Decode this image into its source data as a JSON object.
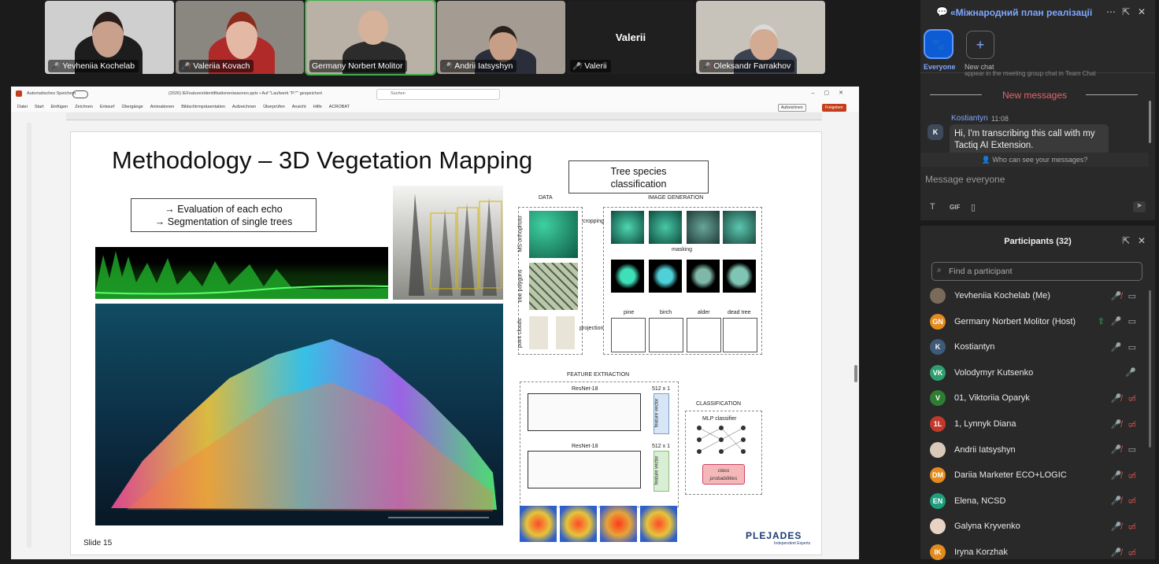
{
  "participants_strip": [
    {
      "name": "Yevheniia Kochelab"
    },
    {
      "name": "Valeriia Kovach"
    },
    {
      "name": "Germany Norbert Molitor"
    },
    {
      "name": "Andrii Iatsyshyn"
    },
    {
      "name": "Valerii",
      "center_label": "Valerii"
    },
    {
      "name": "Oleksandr Farrakhov"
    }
  ],
  "ppt": {
    "autosave": "Automatisches Speichern",
    "file": "(2026) IEFeaturesIdentifikationeniwaoneo.pptx • Auf \"Laufwerk \"P:\"\" gespeichert",
    "search": "Suchen",
    "menu": [
      "Datei",
      "Start",
      "Einfügen",
      "Zeichnen",
      "Entwurf",
      "Übergänge",
      "Animationen",
      "Bildschirmpräsentation",
      "Aufzeichnen",
      "Überprüfen",
      "Ansicht",
      "Hilfe",
      "ACROBAT"
    ],
    "record_btn": "Aufzeichnen",
    "share_btn": "Freigeben",
    "slide_label": "Slide 15"
  },
  "slide": {
    "title": "Methodology – 3D Vegetation Mapping",
    "box1_line1": "→ Evaluation of each echo",
    "box1_line2": "→ Segmentation of single trees",
    "box2_line1": "Tree species",
    "box2_line2": "classification",
    "logo": "PLEJADES",
    "logo_sub": "Independent Experts",
    "diagram": {
      "data": "DATA",
      "image_generation": "IMAGE GENERATION",
      "ms_ortho": "MS orthophoto",
      "tree_polygons": "tree polygons",
      "point_clouds": "point clouds",
      "cropping": "cropping",
      "masking": "masking",
      "projection": "projection",
      "species": [
        "pine",
        "birch",
        "alder",
        "dead tree"
      ],
      "feature_extraction": "FEATURE EXTRACTION",
      "resnet": "ResNet-18",
      "dim": "512 x 1",
      "feature_vector": "feature vector",
      "classification": "CLASSIFICATION",
      "mlp": "MLP classifier",
      "class_prob_1": "class",
      "class_prob_2": "probabilities"
    }
  },
  "chat": {
    "title": "«Міжнародний план реалізації о...",
    "everyone": "Everyone",
    "new_chat": "New chat",
    "cut_text": "appear in the meeting group chat in Team Chat",
    "new_messages": "New messages",
    "author": "Kostiantyn",
    "author_initial": "K",
    "time": "11:08",
    "message": "Hi, I'm transcribing this call with my Tactiq AI Extension.",
    "who_can_see": "Who can see your messages?",
    "placeholder": "Message everyone",
    "gif": "GIF"
  },
  "participants_panel": {
    "title": "Participants (32)",
    "search_placeholder": "Find a participant",
    "list": [
      {
        "initials": "",
        "name": "Yevheniia Kochelab (Me)",
        "color": "#7a6a5a"
      },
      {
        "initials": "GN",
        "name": "Germany Norbert Molitor (Host)",
        "color": "#e38b1f"
      },
      {
        "initials": "K",
        "name": "Kostiantyn",
        "color": "#3e5a78"
      },
      {
        "initials": "VK",
        "name": "Volodymyr Kutsenko",
        "color": "#2f9e6e"
      },
      {
        "initials": "V",
        "name": "01, Viktoriia Oparyk",
        "color": "#2f7d32"
      },
      {
        "initials": "1L",
        "name": "1, Lynnyk Diana",
        "color": "#c0392b"
      },
      {
        "initials": "",
        "name": "Andrii Iatsyshyn",
        "color": "#d8c9b8"
      },
      {
        "initials": "DM",
        "name": "Dariia Marketer ECO+LOGIC",
        "color": "#e38b1f"
      },
      {
        "initials": "EN",
        "name": "Elena, NCSD",
        "color": "#1e9e7d"
      },
      {
        "initials": "",
        "name": "Galyna Kryvenko",
        "color": "#e7d2c4"
      },
      {
        "initials": "IK",
        "name": "Iryna Korzhak",
        "color": "#e38b1f"
      }
    ]
  }
}
